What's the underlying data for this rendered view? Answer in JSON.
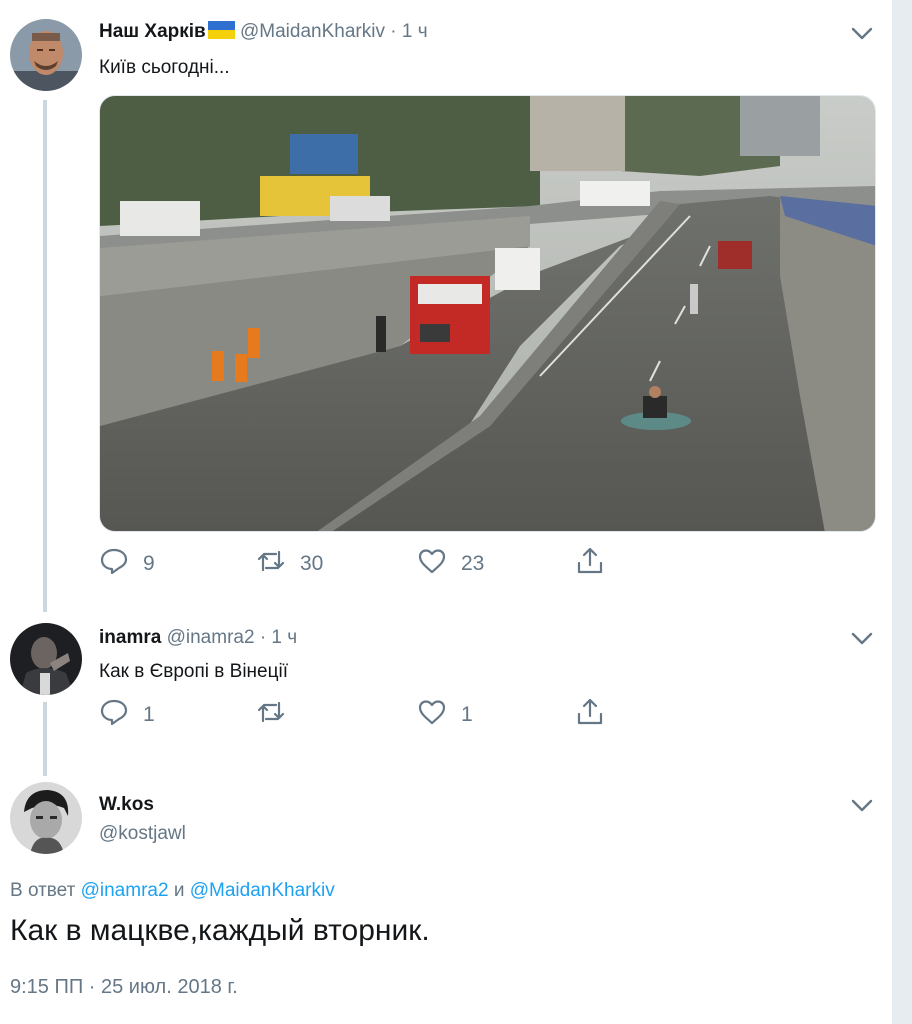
{
  "tweets": [
    {
      "name": "Наш Харків",
      "flag": "flag-ukraine-icon",
      "handle": "@MaidanKharkiv",
      "separator": "·",
      "time": "1 ч",
      "text": "Київ сьогодні...",
      "actions": {
        "replies": "9",
        "retweets": "30",
        "likes": "23"
      }
    },
    {
      "name": "inamra",
      "handle": "@inamra2",
      "separator": "·",
      "time": "1 ч",
      "text": "Как в Європі в Вінеції",
      "actions": {
        "replies": "1",
        "retweets": "",
        "likes": "1"
      }
    }
  ],
  "focused_tweet": {
    "name": "W.kos",
    "handle": "@kostjawl",
    "reply_prefix": "В ответ",
    "reply_mention_1": "@inamra2",
    "reply_joiner": "и",
    "reply_mention_2": "@MaidanKharkiv",
    "text": "Как в мацкве,каждый вторник.",
    "timestamp": "9:15 ПП · 25 июл. 2018 г."
  },
  "colors": {
    "accent": "#1da1f2",
    "secondary_text": "#657786",
    "thread_line": "#ccd6dd",
    "flag_blue": "#2f6fd0",
    "flag_yellow": "#f5d10c"
  }
}
